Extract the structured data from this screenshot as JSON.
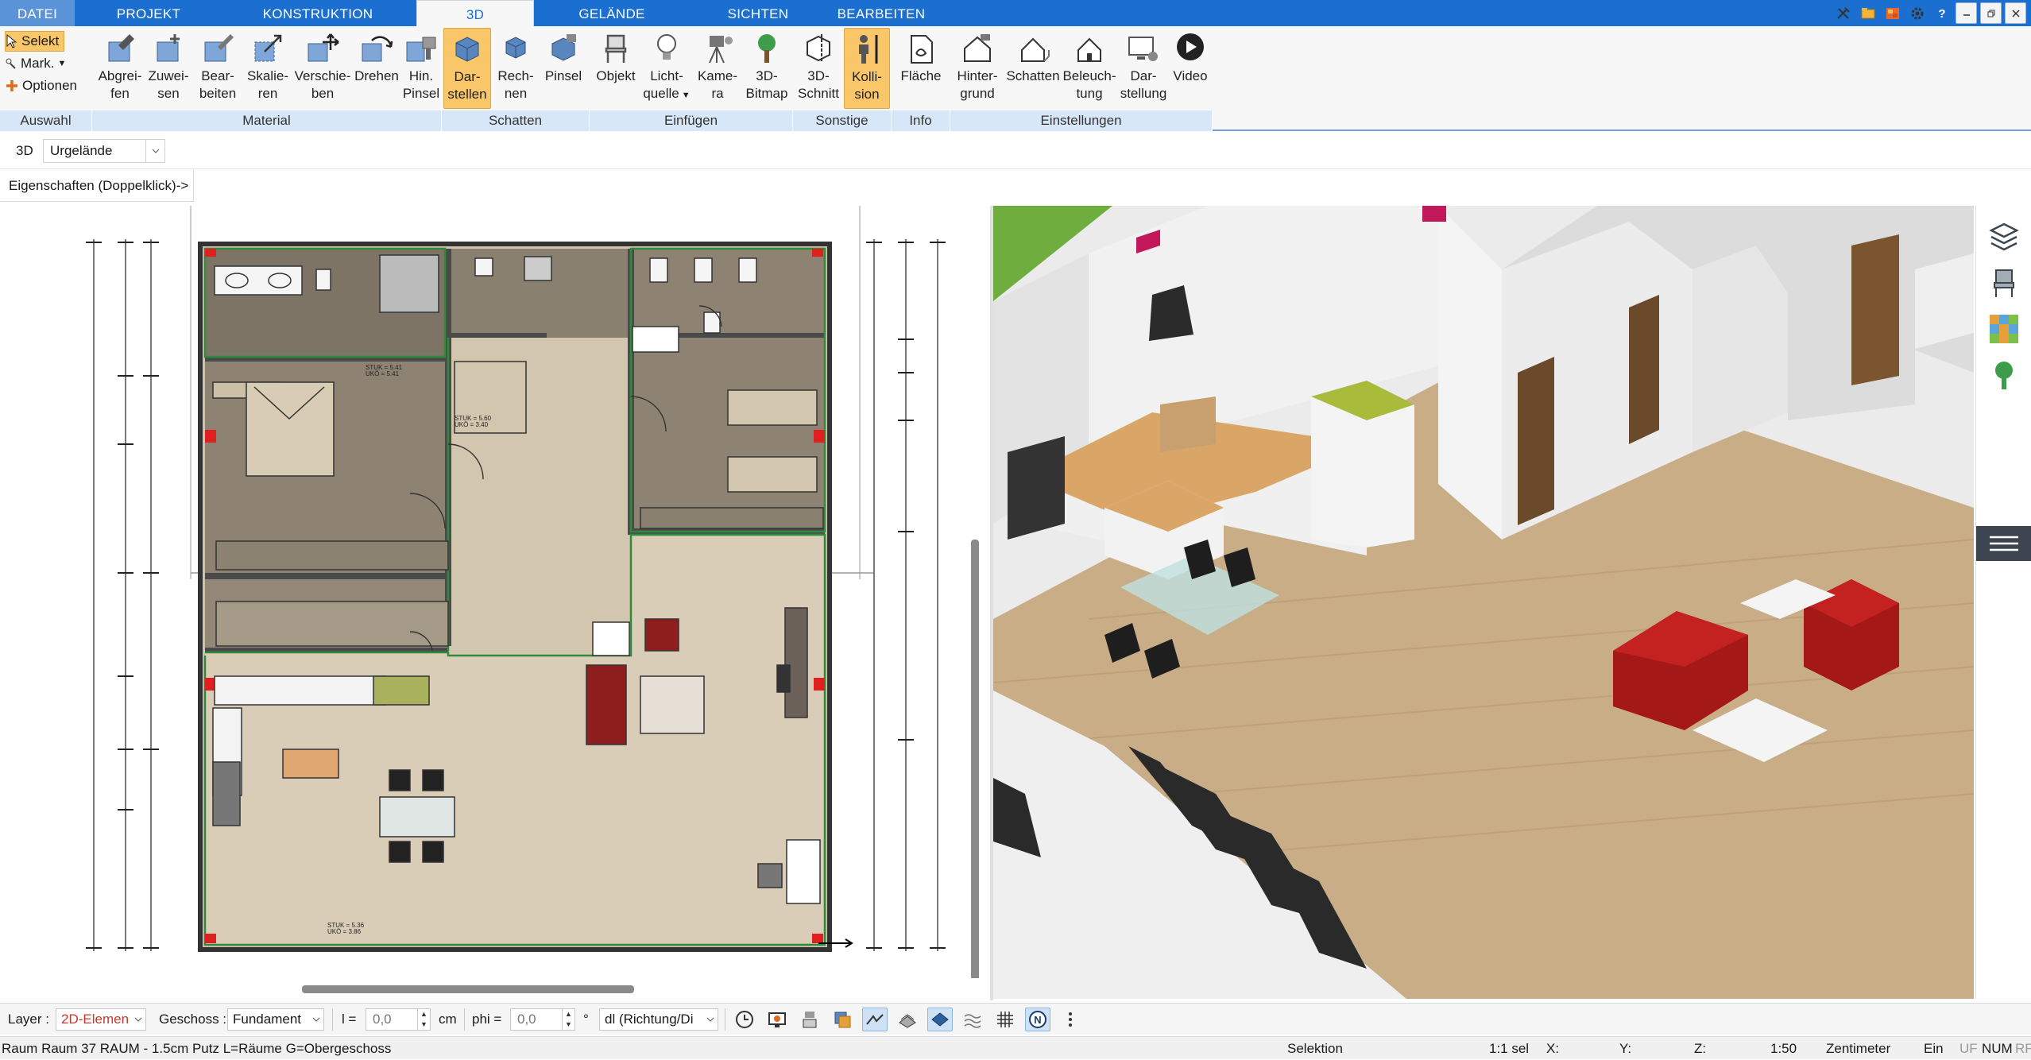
{
  "menu": {
    "tabs": [
      "DATEI",
      "PROJEKT",
      "KONSTRUKTION",
      "3D",
      "GELÄNDE",
      "SICHTEN",
      "BEARBEITEN"
    ]
  },
  "ribbon": {
    "auswahl": {
      "select": "Selekt",
      "mark": "Mark.",
      "options": "Optionen",
      "label": "Auswahl"
    },
    "material": {
      "label": "Material",
      "buttons": [
        {
          "l1": "Abgrei-",
          "l2": "fen"
        },
        {
          "l1": "Zuwei-",
          "l2": "sen"
        },
        {
          "l1": "Bear-",
          "l2": "beiten"
        },
        {
          "l1": "Skalie-",
          "l2": "ren"
        },
        {
          "l1": "Verschie-",
          "l2": "ben"
        },
        {
          "l1": "Drehen",
          "l2": ""
        },
        {
          "l1": "Hin.",
          "l2": "Pinsel"
        }
      ]
    },
    "schatten": {
      "label": "Schatten",
      "buttons": [
        {
          "l1": "Dar-",
          "l2": "stellen"
        },
        {
          "l1": "Rech-",
          "l2": "nen"
        },
        {
          "l1": "Pinsel",
          "l2": ""
        }
      ]
    },
    "einfuegen": {
      "label": "Einfügen",
      "buttons": [
        {
          "l1": "Objekt",
          "l2": ""
        },
        {
          "l1": "Licht-",
          "l2": "quelle"
        },
        {
          "l1": "Kame-",
          "l2": "ra"
        },
        {
          "l1": "3D-",
          "l2": "Bitmap"
        }
      ]
    },
    "sonstige": {
      "label": "Sonstige",
      "buttons": [
        {
          "l1": "3D-",
          "l2": "Schnitt"
        },
        {
          "l1": "Kolli-",
          "l2": "sion"
        }
      ]
    },
    "info": {
      "label": "Info",
      "buttons": [
        {
          "l1": "Fläche",
          "l2": ""
        }
      ]
    },
    "einstellungen": {
      "label": "Einstellungen",
      "buttons": [
        {
          "l1": "Hinter-",
          "l2": "grund"
        },
        {
          "l1": "Schatten",
          "l2": ""
        },
        {
          "l1": "Beleuch-",
          "l2": "tung"
        },
        {
          "l1": "Dar-",
          "l2": "stellung"
        },
        {
          "l1": "Video",
          "l2": ""
        }
      ]
    }
  },
  "toolbar": {
    "mode": "3D",
    "terrain": "Urgelände",
    "properties": "Eigenschaften (Doppelklick)->"
  },
  "plan": {
    "tag_1": "STUK = 5.41",
    "tag_2": "UKÖ = 5.41",
    "tag_3": "STUK = 5.60",
    "tag_4": "UKÖ = 3.40",
    "tag_5": "STUK = 5.36",
    "tag_6": "UKÖ = 3.86"
  },
  "inputbar": {
    "layer_label": "Layer :",
    "layer_value": "2D-Elemen",
    "floor_label": "Geschoss :",
    "floor_value": "Fundament",
    "l_label": "l =",
    "l_value": "0,0",
    "l_unit": "cm",
    "phi_label": "phi =",
    "phi_value": "0,0",
    "phi_unit": "°",
    "dl_value": "dl (Richtung/Di"
  },
  "status": {
    "left": "Raum Raum 37 RAUM - 1.5cm Putz L=Räume G=Obergeschoss",
    "mode": "Selektion",
    "sel": "1:1 sel",
    "x": "X:",
    "y": "Y:",
    "z": "Z:",
    "scale": "1:50",
    "unit": "Zentimeter",
    "ein": "Ein",
    "uf": "UF",
    "num": "NUM",
    "rf": "RF"
  },
  "colors": {
    "accent": "#1b6fd0",
    "highlight": "#f9c66a",
    "ribbon_group": "#d7e7f8"
  }
}
